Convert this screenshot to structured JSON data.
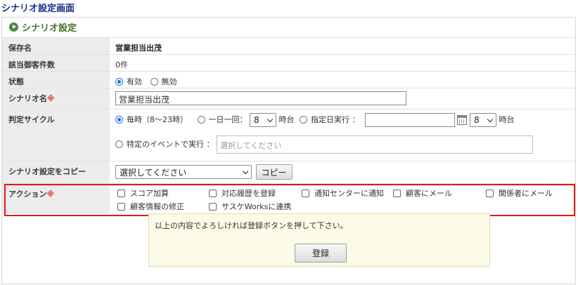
{
  "page": {
    "title": "シナリオ設定画面"
  },
  "panel": {
    "title": "シナリオ設定"
  },
  "colors": {
    "required": "#d93030",
    "highlight_border": "#e01818",
    "header_green": "#44732c"
  },
  "fields": {
    "save_name": {
      "label": "保存名",
      "value": "営業担当出茂"
    },
    "target_count": {
      "label": "該当御客件数",
      "value": "0件"
    },
    "status": {
      "label": "状態",
      "options": [
        "有効",
        "無効"
      ],
      "selected": "有効"
    },
    "scenario_name": {
      "label": "シナリオ名",
      "required_mark": "※",
      "value": "営業担当出茂"
    },
    "cycle": {
      "label": "判定サイクル",
      "hourly": "毎時（8〜23時）",
      "daily": "一日一回：",
      "daily_hour": "8",
      "hour_suffix": "時台",
      "specific_date": "指定日実行 ：",
      "date_value": "",
      "date_hour": "8",
      "event": "特定のイベントで実行 ：",
      "event_placeholder": "選択してください",
      "selected": "hourly"
    },
    "copy": {
      "label": "シナリオ設定をコピー",
      "select_value": "選択してください",
      "button": "コピー"
    },
    "action": {
      "label": "アクション",
      "required_mark": "※",
      "items": [
        "スコア加算",
        "対応履歴を登録",
        "通知センターに通知",
        "顧客にメール",
        "関係者にメール",
        "顧客情報の修正",
        "サスケWorksに連携"
      ]
    }
  },
  "notice": {
    "message": "以上の内容でよろしければ登録ボタンを押して下さい。",
    "register_button": "登録"
  }
}
